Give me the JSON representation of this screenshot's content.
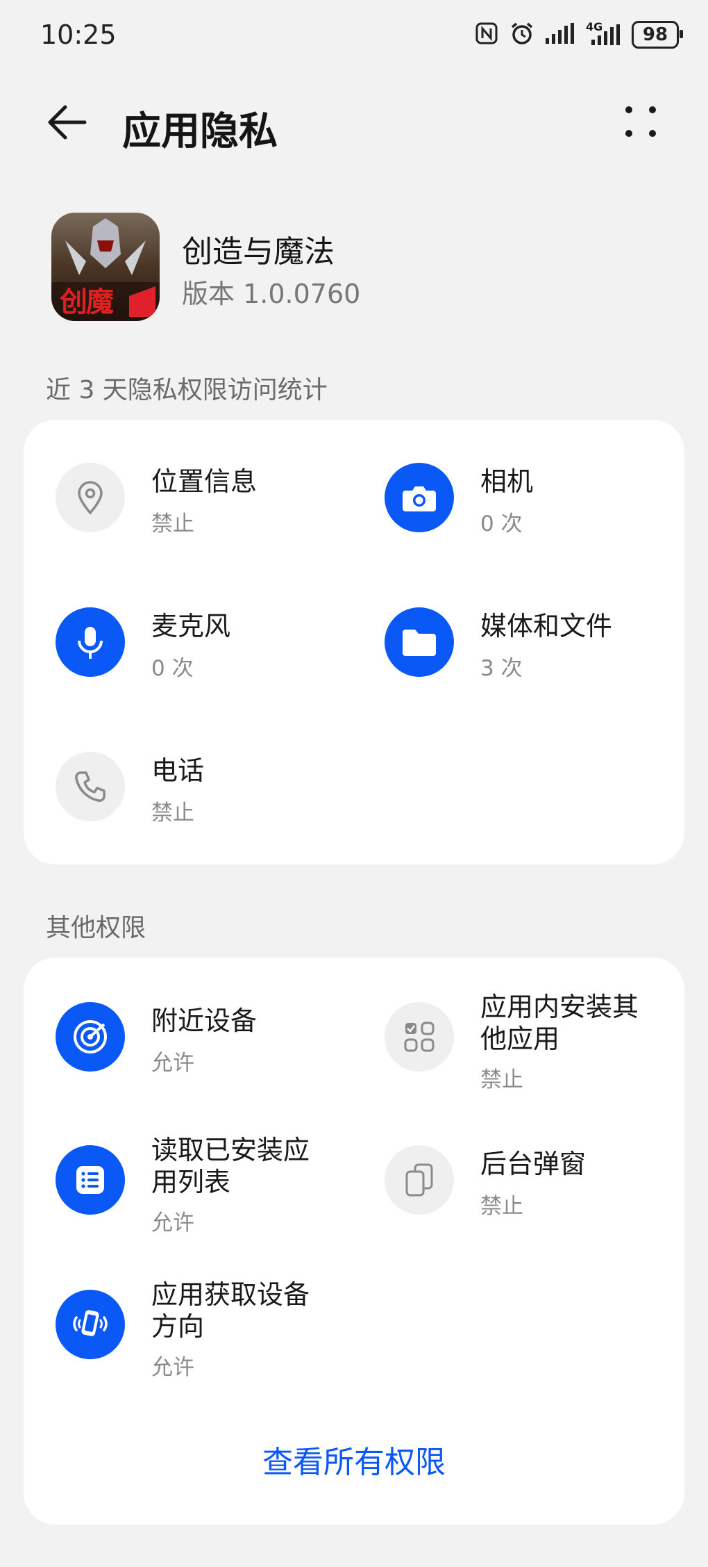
{
  "status_bar": {
    "time": "10:25",
    "network": "4G",
    "battery": "98"
  },
  "header": {
    "title": "应用隐私"
  },
  "app": {
    "name": "创造与魔法",
    "version": "版本 1.0.0760",
    "icon_text": "创魔"
  },
  "section_stats": {
    "label": "近 3 天隐私权限访问统计",
    "items": [
      {
        "name": "位置信息",
        "status": "禁止",
        "icon": "location-icon"
      },
      {
        "name": "相机",
        "status": "0 次",
        "icon": "camera-icon"
      },
      {
        "name": "麦克风",
        "status": "0 次",
        "icon": "microphone-icon"
      },
      {
        "name": "媒体和文件",
        "status": "3 次",
        "icon": "folder-icon"
      },
      {
        "name": "电话",
        "status": "禁止",
        "icon": "phone-icon"
      }
    ]
  },
  "section_other": {
    "label": "其他权限",
    "items": [
      {
        "name": "附近设备",
        "status": "允许",
        "icon": "nearby-devices-icon"
      },
      {
        "name": "应用内安装其他应用",
        "status": "禁止",
        "icon": "install-apps-icon"
      },
      {
        "name": "读取已安装应用列表",
        "status": "允许",
        "icon": "app-list-icon"
      },
      {
        "name": "后台弹窗",
        "status": "禁止",
        "icon": "background-popup-icon"
      },
      {
        "name": "应用获取设备方向",
        "status": "允许",
        "icon": "device-orientation-icon"
      }
    ]
  },
  "footer": {
    "view_all": "查看所有权限"
  },
  "colors": {
    "accent": "#0a59f7",
    "background": "#f2f2f2",
    "card": "#ffffff"
  }
}
